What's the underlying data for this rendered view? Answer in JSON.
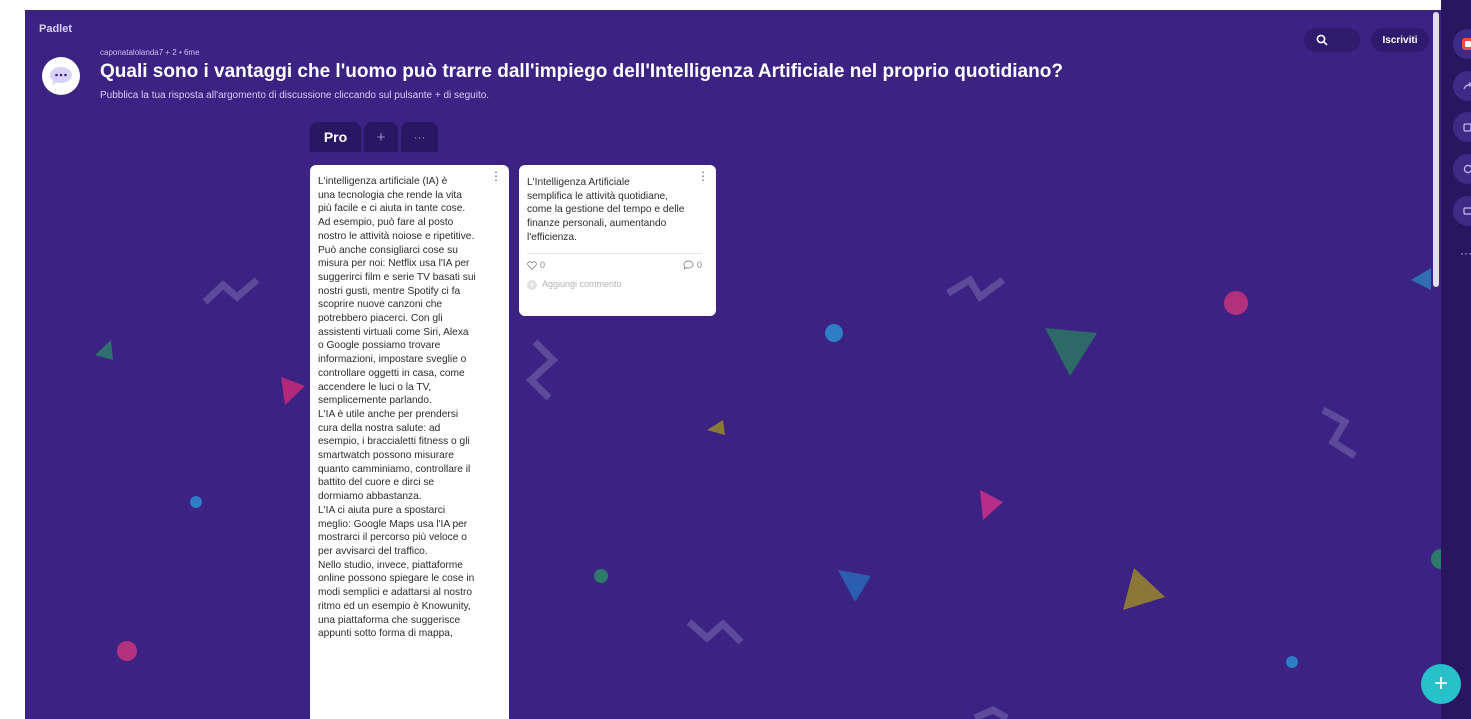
{
  "app": {
    "brand": "Padlet"
  },
  "header": {
    "meta": "caponatalolanda7 + 2 • 6me",
    "title": "Quali sono i vantaggi che l'uomo può trarre dall'impiego dell'Intelligenza Artificiale nel proprio quotidiano?",
    "subtitle": "Pubblica la tua risposta all'argomento di discussione cliccando sul pulsante + di seguito.",
    "signup_label": "Iscriviti"
  },
  "section": {
    "name": "Pro",
    "add_label": "+",
    "more_label": "···"
  },
  "posts": [
    {
      "text": "L'intelligenza artificiale (IA) è\nuna tecnologia che rende la vita\npiù facile e ci aiuta in tante cose.\nAd esempio, può fare al posto\nnostro le attività noiose e ripetitive.\nPuò anche consigliarci cose su\nmisura per noi: Netflix usa l'IA per\nsuggerirci film e serie TV basati sui\nnostri gusti, mentre Spotify ci fa\nscoprire nuove canzoni che\npotrebbero piacerci. Con gli\nassistenti virtuali come Siri, Alexa\no Google possiamo trovare\ninformazioni, impostare sveglie o\ncontrollare oggetti in casa, come\naccendere le luci o la TV,\nsemplicemente parlando.\nL'IA è utile anche per prendersi\ncura della nostra salute: ad\nesempio, i braccialetti fitness o gli\nsmartwatch possono misurare\nquanto camminiamo, controllare il\nbattito del cuore e dirci se\ndormiamo abbastanza.\nL'IA ci aiuta pure a spostarci\nmeglio: Google Maps usa l'IA per\nmostrarci il percorso più veloce o\nper avvisarci del traffico.\nNello studio, invece, piattaforme\nonline possono spiegare le cose in\nmodi semplici e adattarsi al nostro\nritmo ed un esempio è Knowunity,\nuna piattaforma che suggerisce\nappunti sotto forma di mappa,"
    },
    {
      "text": "L'Intelligenza Artificiale\nsemplifica le attività quotidiane,\ncome la gestione del tempo e delle\nfinanze personali, aumentando\nl'efficienza.",
      "likes": "0",
      "comments": "0",
      "add_comment": "Aggiungi commento"
    }
  ],
  "fab": {
    "label": "+"
  },
  "colors": {
    "board_bg": "#3c2283",
    "fab": "#26c1c9",
    "card": "#ffffff"
  }
}
